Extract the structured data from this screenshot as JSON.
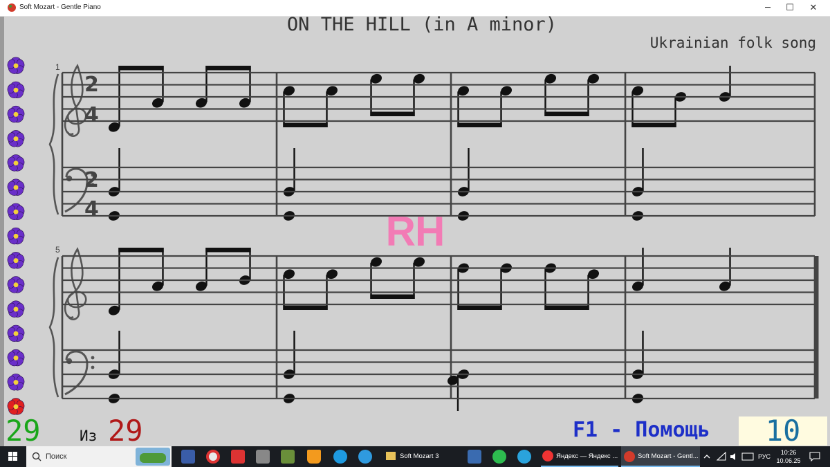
{
  "window": {
    "title": "Soft Mozart - Gentle Piano",
    "minimize": "─",
    "maximize": "☐",
    "close": "✕"
  },
  "score": {
    "title": "ON THE HILL (in A minor)",
    "subtitle": "Ukrainian folk song",
    "hand_label": "RH",
    "systems": [
      {
        "measure_number": "1",
        "time_signature": [
          "2",
          "4"
        ]
      },
      {
        "measure_number": "5"
      }
    ]
  },
  "status": {
    "current": "29",
    "of_label": "Из",
    "total": "29",
    "help": "F1 - Помощь",
    "score_value": "10"
  },
  "colors": {
    "current": "#1aa61a",
    "total": "#b01818",
    "help": "#1d2fc8",
    "hand_label": "#f27bb5",
    "flower": "#6a2fc9",
    "flower_active": "#e02020"
  },
  "sidebar": {
    "flower_count": 15,
    "active_index": 14
  },
  "taskbar": {
    "search_placeholder": "Поиск",
    "apps": [
      {
        "label": "Soft Mozart 3",
        "icon": "folder-icon"
      },
      {
        "label": "Яндекс — Яндекс ...",
        "icon": "yandex-browser-icon"
      },
      {
        "label": "Soft Mozart - Gentl...",
        "icon": "soft-mozart-icon"
      }
    ],
    "language": "РУС",
    "time": "10:26",
    "date": "10.06.25"
  }
}
